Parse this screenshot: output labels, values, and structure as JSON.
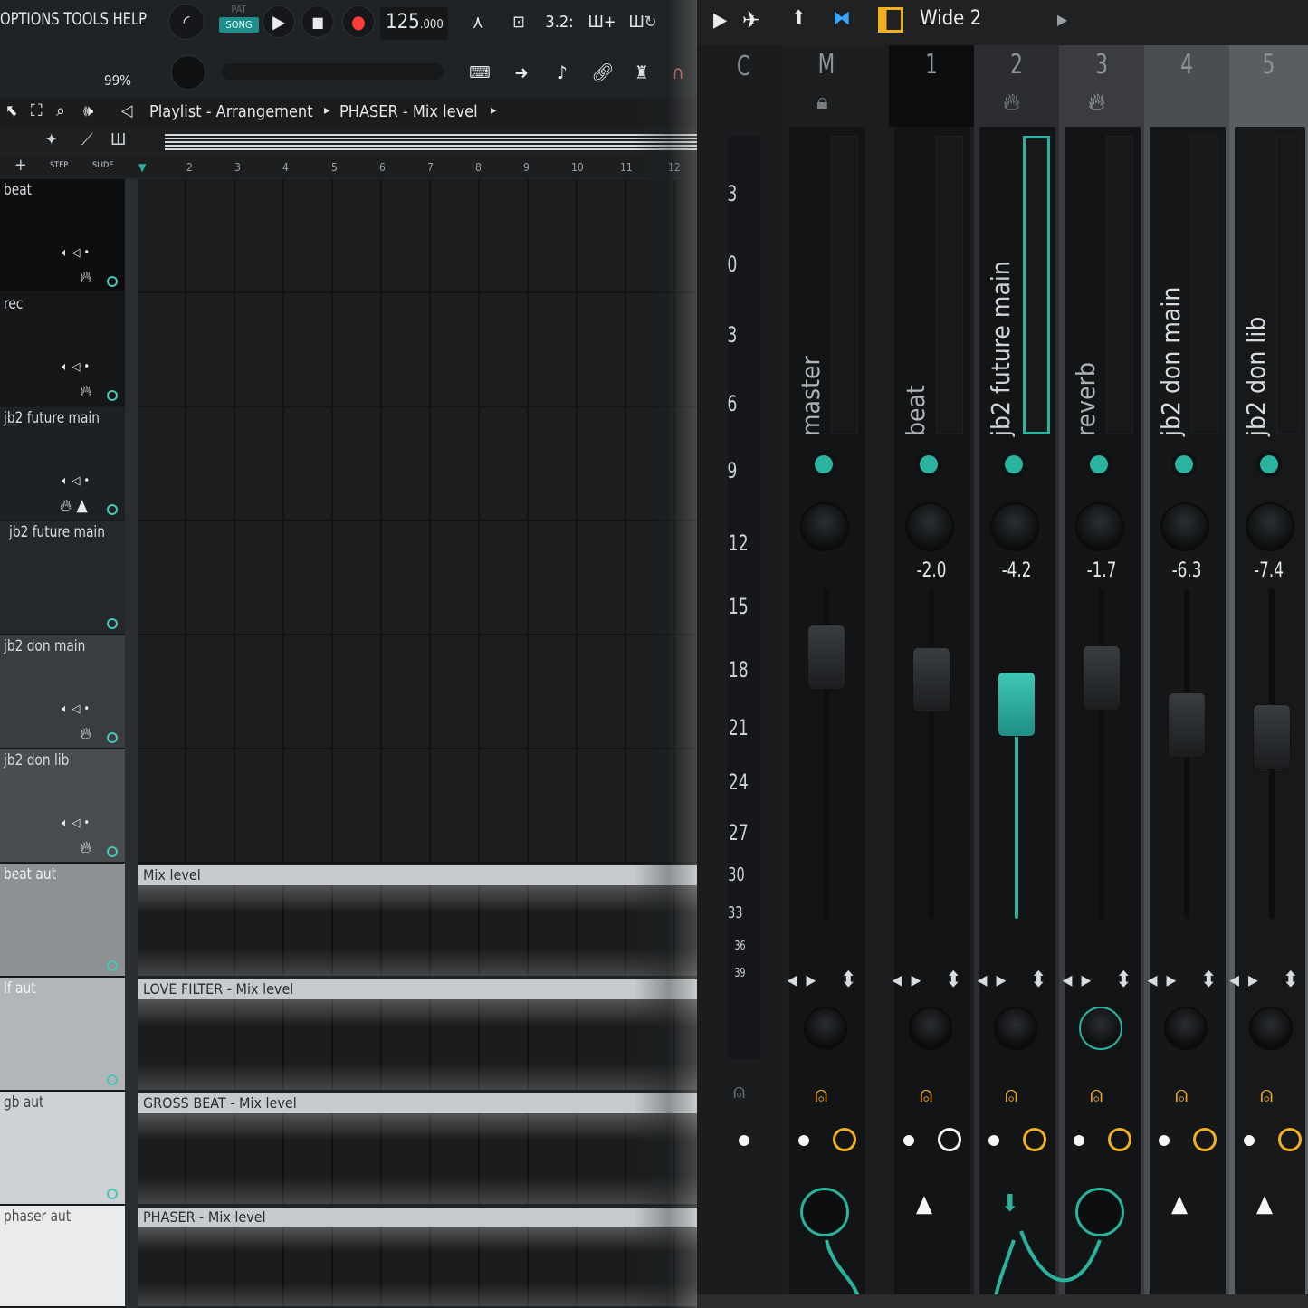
{
  "menu": {
    "text": "OPTIONS TOOLS HELP"
  },
  "transport": {
    "pat": "PAT",
    "song": "SONG",
    "tempo": "125",
    "tempo_dec": ".000",
    "time_sig": "3.2:",
    "cpu": "99%"
  },
  "playlist": {
    "title": "Playlist - Arrangement",
    "sep1": "▸",
    "target": "PHASER - Mix level",
    "sep2": "▸",
    "step": "STEP",
    "slide": "SLIDE"
  },
  "ruler": [
    "2",
    "3",
    "4",
    "5",
    "6",
    "7",
    "8",
    "9",
    "10",
    "11",
    "12"
  ],
  "tracks": [
    {
      "name": "beat"
    },
    {
      "name": "rec"
    },
    {
      "name": "jb2 future main"
    },
    {
      "name": "jb2 future main"
    },
    {
      "name": "jb2 don main"
    },
    {
      "name": "jb2 don lib"
    },
    {
      "name": "beat aut",
      "clip": "Mix level"
    },
    {
      "name": "lf aut",
      "clip": "LOVE FILTER - Mix level"
    },
    {
      "name": "gb aut",
      "clip": "GROSS BEAT - Mix level"
    },
    {
      "name": "phaser aut",
      "clip": "PHASER - Mix level"
    }
  ],
  "mixer": {
    "preset": "Wide 2",
    "col_c": "C",
    "col_m": "M",
    "db_scale": [
      "3",
      "0",
      "3",
      "6",
      "9",
      "12",
      "15",
      "18",
      "21",
      "24",
      "27",
      "30",
      "33",
      "36",
      "39"
    ],
    "channels": [
      {
        "num": "M",
        "label": "master",
        "value": ""
      },
      {
        "num": "1",
        "label": "beat",
        "value": "-2.0"
      },
      {
        "num": "2",
        "label": "jb2 future main",
        "value": "-4.2"
      },
      {
        "num": "3",
        "label": "reverb",
        "value": "-1.7"
      },
      {
        "num": "4",
        "label": "jb2 don main",
        "value": "-6.3"
      },
      {
        "num": "5",
        "label": "jb2 don lib",
        "value": "-7.4"
      }
    ]
  },
  "colors": {
    "accent": "#2ab39f",
    "bulb": "#f0a820"
  }
}
